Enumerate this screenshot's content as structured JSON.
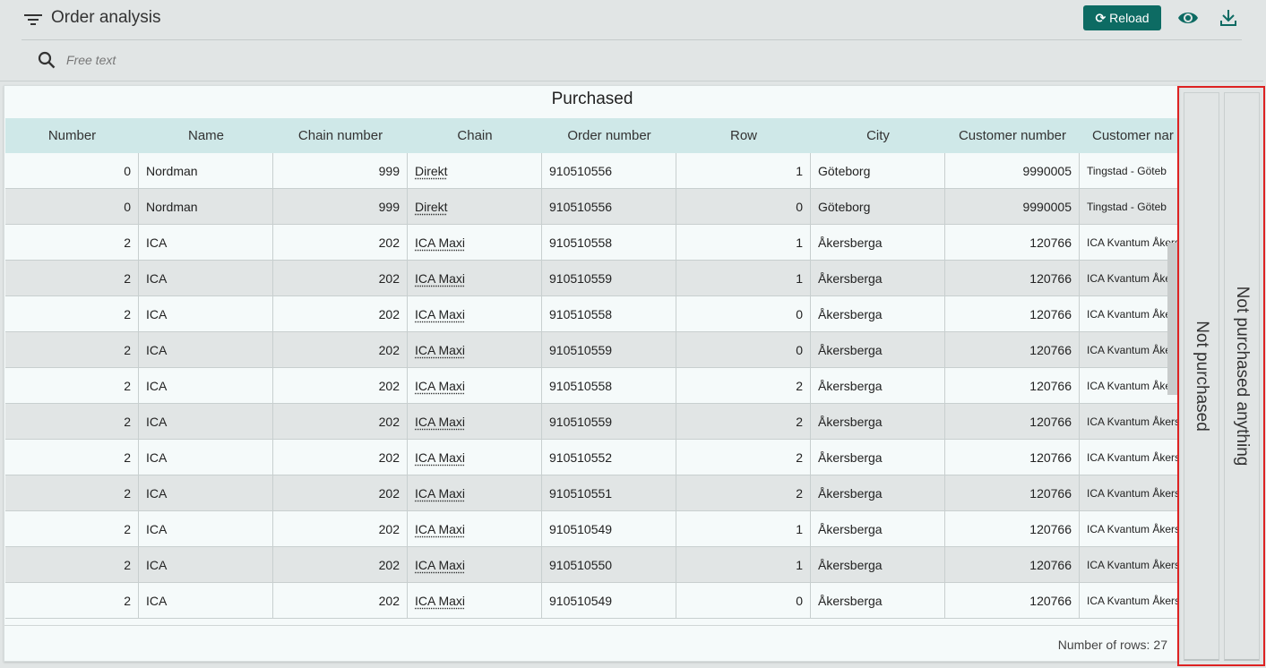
{
  "header": {
    "title": "Order analysis",
    "reload_label": "Reload",
    "search_placeholder": "Free text"
  },
  "table": {
    "title": "Purchased",
    "columns": [
      "Number",
      "Name",
      "Chain number",
      "Chain",
      "Order number",
      "Row",
      "City",
      "Customer number",
      "Customer nar"
    ],
    "rows": [
      [
        "0",
        "Nordman",
        "999",
        "Direkt",
        "910510556",
        "1",
        "Göteborg",
        "9990005",
        "Tingstad - Göteb"
      ],
      [
        "0",
        "Nordman",
        "999",
        "Direkt",
        "910510556",
        "0",
        "Göteborg",
        "9990005",
        "Tingstad - Göteb"
      ],
      [
        "2",
        "ICA",
        "202",
        "ICA Maxi",
        "910510558",
        "1",
        "Åkersberga",
        "120766",
        "ICA Kvantum Åkers"
      ],
      [
        "2",
        "ICA",
        "202",
        "ICA Maxi",
        "910510559",
        "1",
        "Åkersberga",
        "120766",
        "ICA Kvantum Åkers"
      ],
      [
        "2",
        "ICA",
        "202",
        "ICA Maxi",
        "910510558",
        "0",
        "Åkersberga",
        "120766",
        "ICA Kvantum Åkers"
      ],
      [
        "2",
        "ICA",
        "202",
        "ICA Maxi",
        "910510559",
        "0",
        "Åkersberga",
        "120766",
        "ICA Kvantum Åkers"
      ],
      [
        "2",
        "ICA",
        "202",
        "ICA Maxi",
        "910510558",
        "2",
        "Åkersberga",
        "120766",
        "ICA Kvantum Åkers"
      ],
      [
        "2",
        "ICA",
        "202",
        "ICA Maxi",
        "910510559",
        "2",
        "Åkersberga",
        "120766",
        "ICA Kvantum Åkers"
      ],
      [
        "2",
        "ICA",
        "202",
        "ICA Maxi",
        "910510552",
        "2",
        "Åkersberga",
        "120766",
        "ICA Kvantum Åkers"
      ],
      [
        "2",
        "ICA",
        "202",
        "ICA Maxi",
        "910510551",
        "2",
        "Åkersberga",
        "120766",
        "ICA Kvantum Åkers"
      ],
      [
        "2",
        "ICA",
        "202",
        "ICA Maxi",
        "910510549",
        "1",
        "Åkersberga",
        "120766",
        "ICA Kvantum Åkers"
      ],
      [
        "2",
        "ICA",
        "202",
        "ICA Maxi",
        "910510550",
        "1",
        "Åkersberga",
        "120766",
        "ICA Kvantum Åkers"
      ],
      [
        "2",
        "ICA",
        "202",
        "ICA Maxi",
        "910510549",
        "0",
        "Åkersberga",
        "120766",
        "ICA Kvantum Åkers"
      ]
    ],
    "row_count_label": "Number of rows:",
    "row_count": "27"
  },
  "side_tabs": {
    "not_purchased": "Not purchased",
    "not_purchased_anything": "Not purchased anything"
  },
  "colors": {
    "accent": "#0d6b63",
    "header_row": "#cfe8e8",
    "highlight": "#dd2222"
  },
  "icons": [
    "filter-icon",
    "reload-icon",
    "eye-icon",
    "download-icon",
    "search-icon"
  ]
}
